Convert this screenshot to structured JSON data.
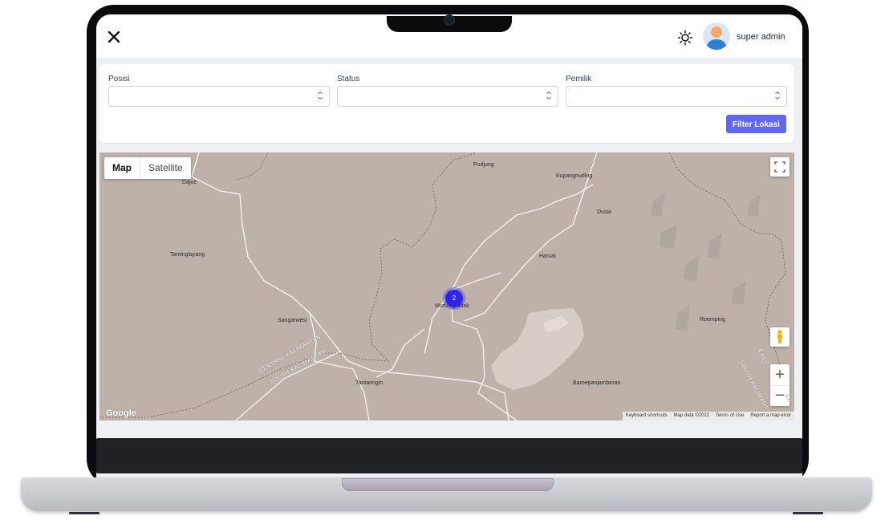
{
  "app": {
    "user_name": "super admin"
  },
  "filters": {
    "posisi": {
      "label": "Posisi",
      "value": ""
    },
    "status": {
      "label": "Status",
      "value": ""
    },
    "pemilik": {
      "label": "Pemilik",
      "value": ""
    },
    "button_label": "Filter Lokasi"
  },
  "map": {
    "type_options": [
      "Map",
      "Satellite"
    ],
    "active_type": "Map",
    "cluster_count": "2",
    "places": [
      "Pudjung",
      "Kupangnuding",
      "Dajoe",
      "Dusia",
      "Taminglayang",
      "Haruai",
      "Murungpudak",
      "Sangarwesi",
      "Roemping",
      "Tantaringin",
      "Baroepanjamberan"
    ],
    "region_labels": [
      "CENTRAL KALIMANTAN",
      "SOUTH KALIMANTAN",
      "EAST",
      "SOUTH KALIMANT",
      "AN"
    ],
    "logo": "Google",
    "attribution": [
      "Keyboard shortcuts",
      "Map data ©2022",
      "Terms of Use",
      "Report a map error"
    ],
    "zoom_in": "+",
    "zoom_out": "−"
  },
  "icons": {
    "close": "close-icon",
    "theme": "sun-icon",
    "fullscreen": "fullscreen-icon",
    "pegman": "pegman-icon",
    "select_arrows": "select-arrows-icon"
  },
  "colors": {
    "accent": "#6366f1",
    "cluster": "#2f25e8",
    "map_land": "#bdb1aa",
    "laptop_frame": "#0b0b0d"
  }
}
